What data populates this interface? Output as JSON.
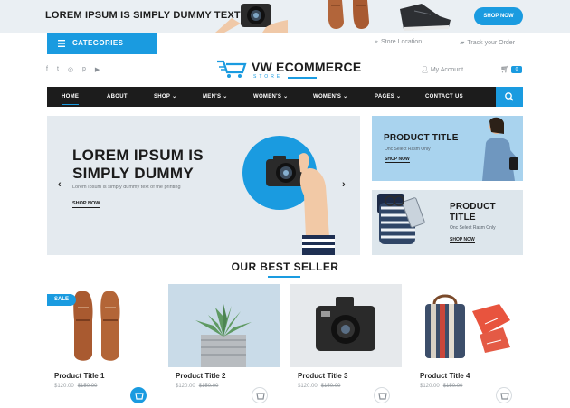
{
  "promo": {
    "text": "LOREM IPSUM IS SIMPLY DUMMY TEXT",
    "shop_label": "SHOP NOW"
  },
  "topbar": {
    "categories_label": "CATEGORIES",
    "store_location": "Store Location",
    "track_order": "Track your Order"
  },
  "social": {
    "icons": [
      "facebook-icon",
      "twitter-icon",
      "instagram-icon",
      "pinterest-icon",
      "youtube-icon"
    ]
  },
  "logo": {
    "title": "VW ECOMMERCE",
    "subtitle": "STORE"
  },
  "header": {
    "account_label": "My Account",
    "cart_count": "0"
  },
  "nav": {
    "items": [
      {
        "label": "HOME",
        "dropdown": false
      },
      {
        "label": "ABOUT",
        "dropdown": false
      },
      {
        "label": "SHOP",
        "dropdown": true
      },
      {
        "label": "MEN'S",
        "dropdown": true
      },
      {
        "label": "WOMEN'S",
        "dropdown": true
      },
      {
        "label": "WOMEN'S",
        "dropdown": true
      },
      {
        "label": "PAGES",
        "dropdown": true
      },
      {
        "label": "CONTACT US",
        "dropdown": false
      }
    ]
  },
  "hero": {
    "title_line1": "LOREM IPSUM IS",
    "title_line2": "SIMPLY DUMMY",
    "subtitle": "Lorem Ipsum is simply dummy text of the printing",
    "shop_label": "SHOP NOW"
  },
  "side_promos": [
    {
      "title_line1": "PRODUCT TITLE",
      "title_line2": "",
      "subtitle": "Onc Select Rasm Only",
      "shop_label": "SHOP NOW"
    },
    {
      "title_line1": "PRODUCT",
      "title_line2": "TITLE",
      "subtitle": "Onc Select Rasm Only",
      "shop_label": "SHOP NOW"
    }
  ],
  "best_seller": {
    "title": "OUR BEST SELLER",
    "sale_badge": "SALE",
    "products": [
      {
        "name": "Product Title 1",
        "price": "$120.00",
        "old_price": "$150.00"
      },
      {
        "name": "Product Title 2",
        "price": "$120.00",
        "old_price": "$150.00"
      },
      {
        "name": "Product Title 3",
        "price": "$120.00",
        "old_price": "$150.00"
      },
      {
        "name": "Product Title 4",
        "price": "$120.00",
        "old_price": "$150.00"
      }
    ]
  },
  "colors": {
    "accent": "#1a9be0",
    "nav_bg": "#1c1c1c",
    "hero_bg": "#e4eaef"
  }
}
